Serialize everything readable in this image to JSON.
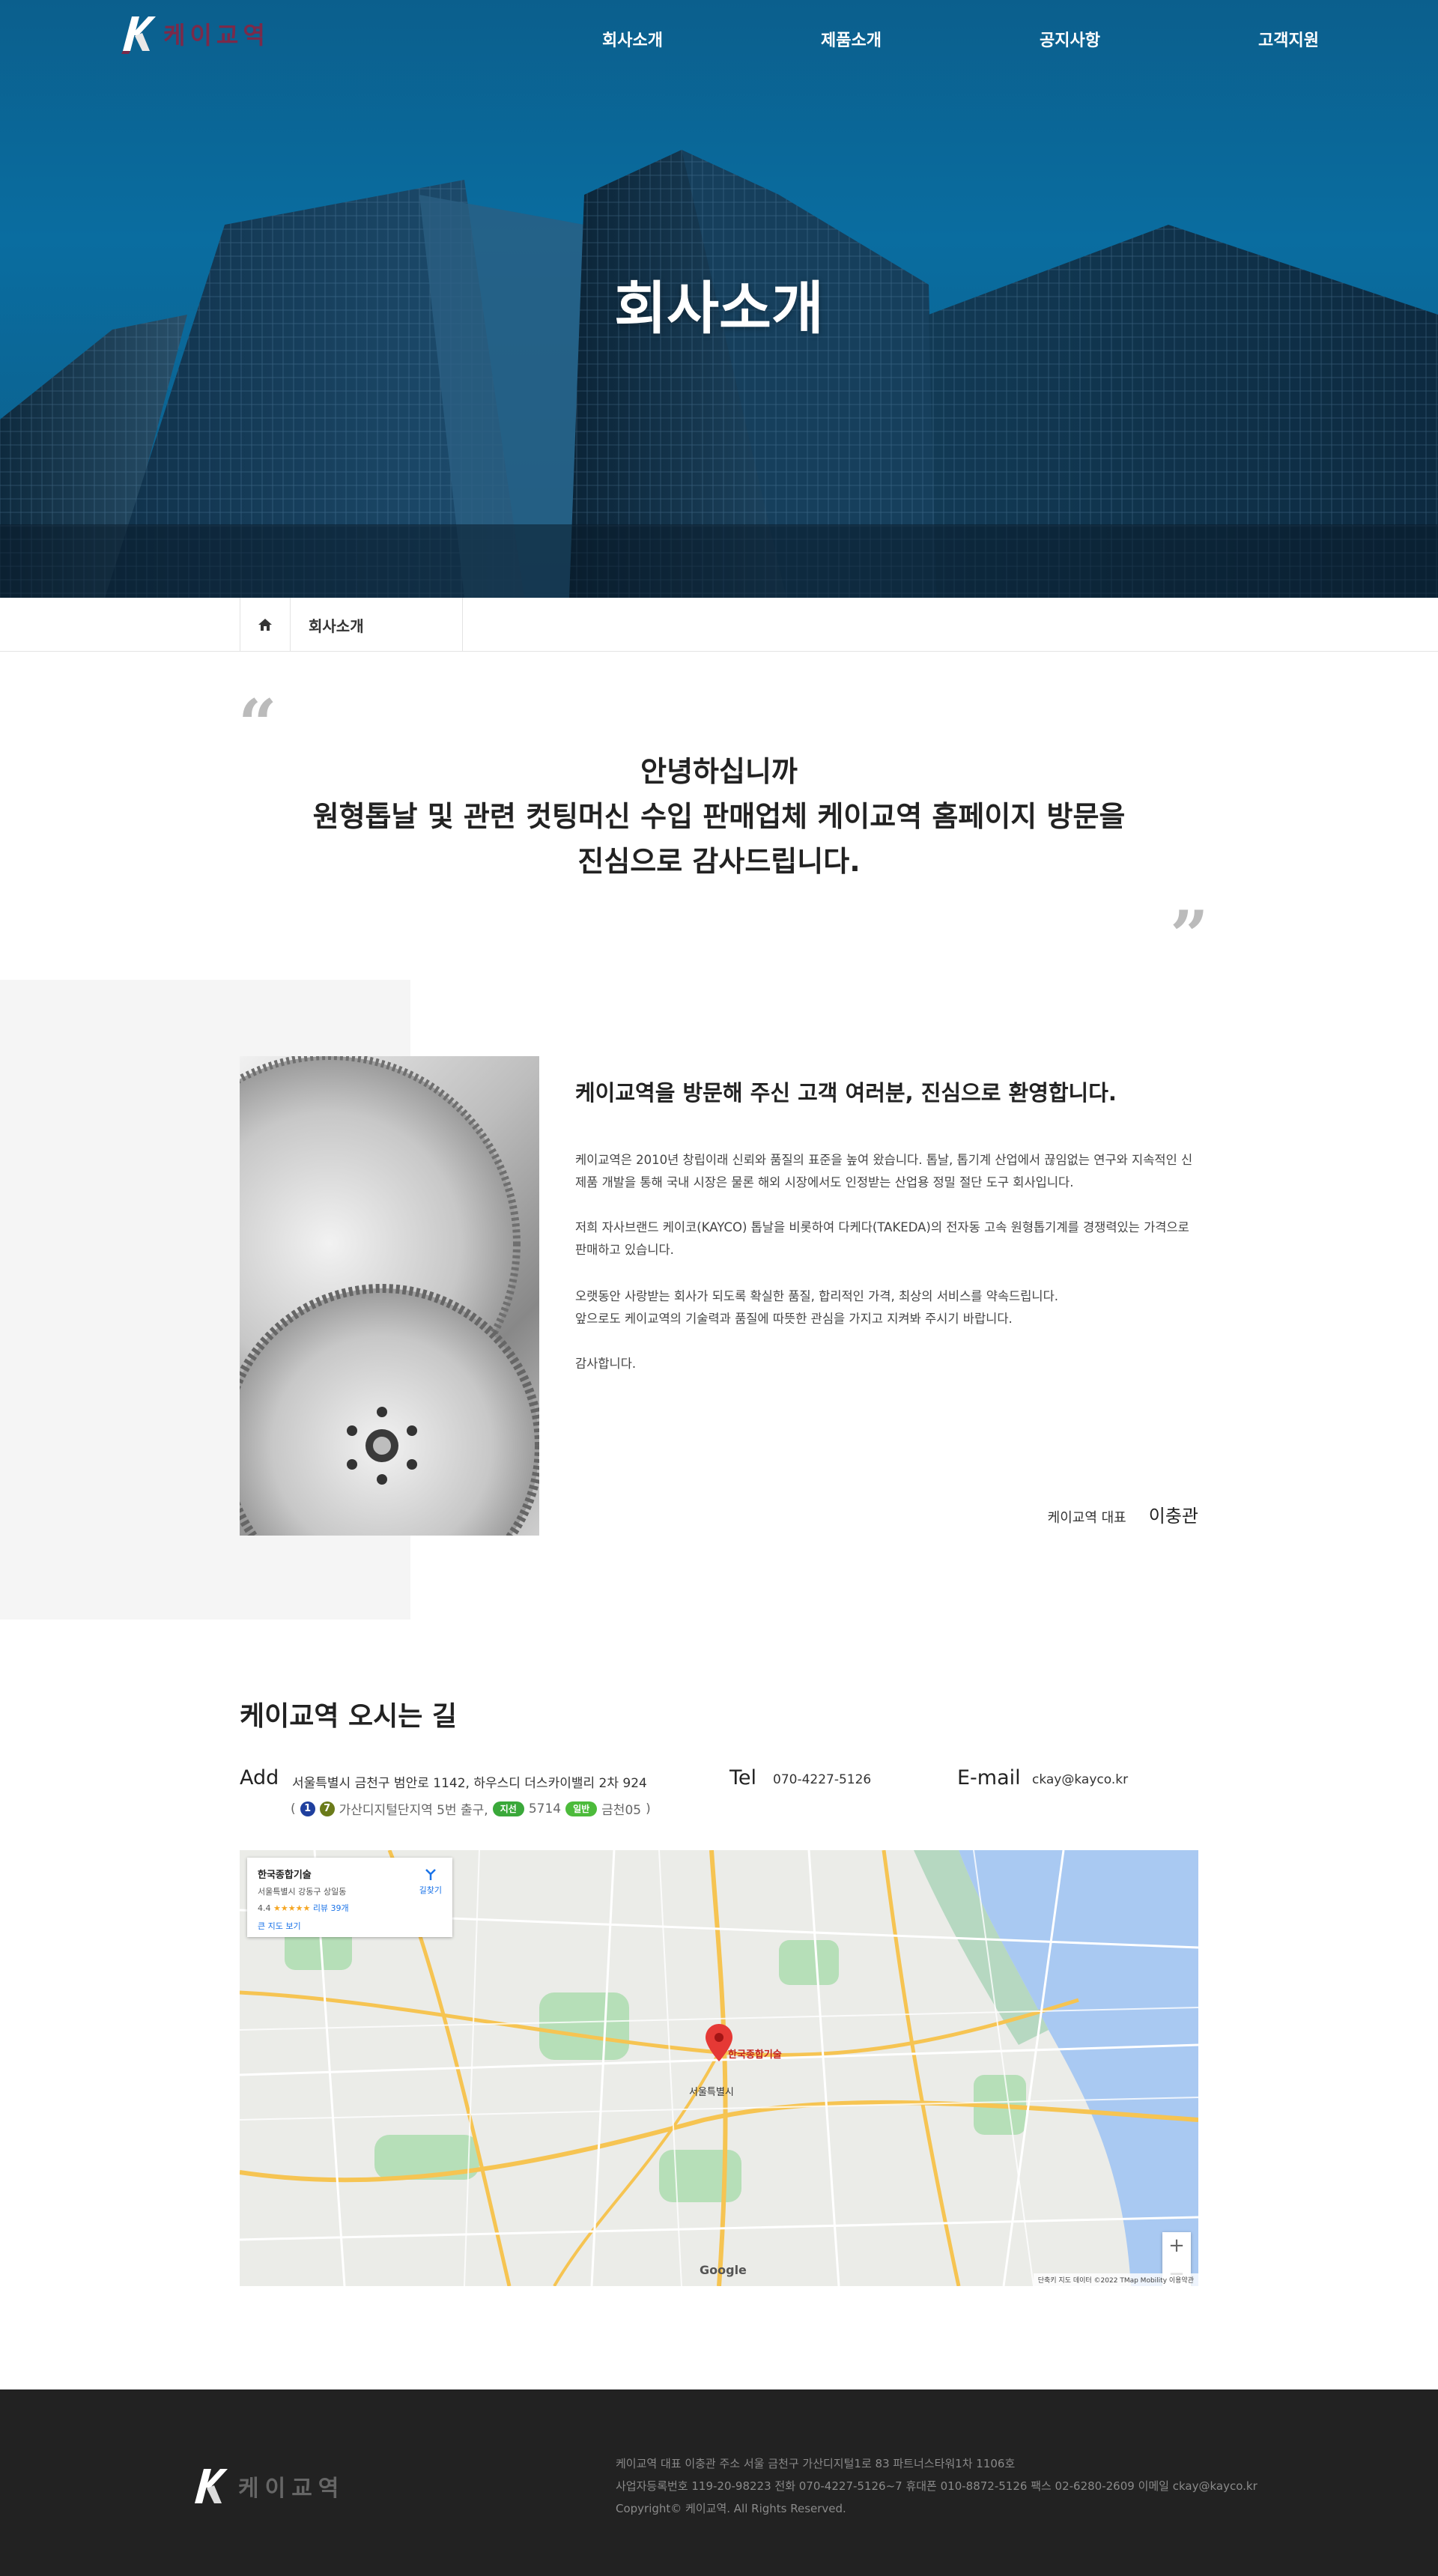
{
  "brand": {
    "name": "케이교역"
  },
  "nav": {
    "items": [
      "회사소개",
      "제품소개",
      "공지사항",
      "고객지원"
    ]
  },
  "hero": {
    "title": "회사소개"
  },
  "breadcrumb": {
    "current": "회사소개"
  },
  "greeting": {
    "line1": "안녕하십니까",
    "line2": "원형톱날 및 관련 컷팅머신 수입 판매업체 케이교역 홈페이지 방문을",
    "line3": "진심으로 감사드립니다."
  },
  "intro": {
    "heading": "케이교역을 방문해 주신 고객 여러분, 진심으로 환영합니다.",
    "p1": "케이교역은 2010년 창립이래 신뢰와 품질의 표준을 높여 왔습니다. 톱날, 톱기계 산업에서 끊임없는 연구와 지속적인 신제품 개발을 통해 국내 시장은 물론 해외 시장에서도 인정받는 산업용 정밀 절단 도구 회사입니다.",
    "p2": "저희 자사브랜드 케이코(KAYCO) 톱날을 비롯하여 다케다(TAKEDA)의 전자동 고속 원형톱기계를 경쟁력있는 가격으로 판매하고 있습니다.",
    "p3a": "오랫동안 사랑받는 회사가 되도록 확실한 품질, 합리적인 가격, 최상의 서비스를 약속드립니다.",
    "p3b": "앞으로도 케이교역의 기술력과 품질에 따뜻한 관심을 가지고 지켜봐 주시기 바랍니다.",
    "p4": "감사합니다.",
    "sign_role": "케이교역 대표",
    "sign_name": "이충관"
  },
  "location": {
    "title": "케이교역 오시는 길",
    "add_label": "Add",
    "address": "서울특별시 금천구 범안로 1142, 하우스디 더스카이밸리 2차 924",
    "tel_label": "Tel",
    "tel": "070-4227-5126",
    "email_label": "E-mail",
    "email": "ckay@kayco.kr",
    "transit": {
      "open": "(",
      "line1": "1",
      "line7": "7",
      "station": "가산디지털단지역 5번 출구,",
      "bus_trunk_label": "지선",
      "bus_trunk": "5714",
      "bus_normal_label": "일반",
      "bus_normal": "금천05",
      "close": ")"
    }
  },
  "map": {
    "place_name": "한국종합기술",
    "place_address": "서울특별시 강동구 상일동",
    "rating": "4.4",
    "stars": "★★★★★",
    "reviews": "리뷰 39개",
    "larger_map": "큰 지도 보기",
    "directions": "길찾기",
    "pin_label": "한국종합기술",
    "city_label": "서울특별시",
    "zoom_in": "+",
    "zoom_out": "−",
    "google": "Google",
    "attribution": "단축키  지도 데이터 ©2022 TMap Mobility  이용약관"
  },
  "footer": {
    "brand": "케이교역",
    "line1": "케이교역   대표 이충관   주소 서울 금천구 가산디지털1로 83 파트너스타워1차 1106호",
    "line2": "사업자등록번호 119-20-98223   전화 070-4227-5126~7   휴대폰 010-8872-5126   팩스 02-6280-2609   이메일 ckay@kayco.kr",
    "line3": "Copyright© 케이교역. All Rights Reserved."
  },
  "colors": {
    "hero_blue": "#0a6da0",
    "footer_bg": "#222222",
    "brand_accent": "#7a2a4a",
    "pin_red": "#e53935"
  },
  "icons": {
    "home": "home-icon",
    "quote_open": "quote-open-icon",
    "quote_close": "quote-close-icon",
    "map_pin": "map-pin-icon"
  }
}
